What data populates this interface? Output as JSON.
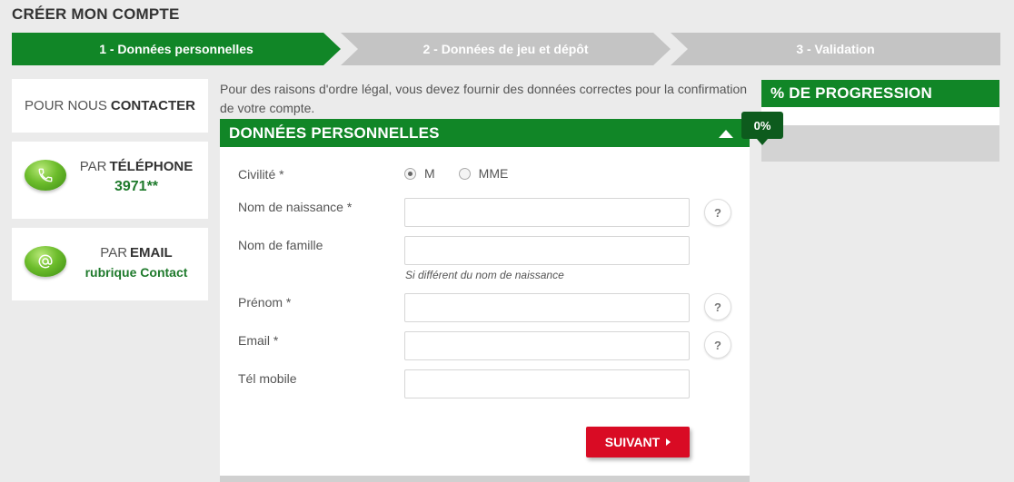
{
  "page": {
    "title": "CRÉER MON COMPTE"
  },
  "steps": [
    {
      "label": "1 - Données personnelles",
      "active": true
    },
    {
      "label": "2 - Données de jeu et dépôt",
      "active": false
    },
    {
      "label": "3 - Validation",
      "active": false
    }
  ],
  "contact": {
    "title_prefix": "POUR NOUS",
    "title_strong": "CONTACTER",
    "phone": {
      "prefix": "PAR",
      "label": "TÉLÉPHONE",
      "value": "3971**",
      "icon": "phone-icon"
    },
    "email": {
      "prefix": "PAR",
      "label": "EMAIL",
      "value": "rubrique Contact",
      "icon": "at-sign-icon"
    }
  },
  "intro": "Pour des raisons d'ordre légal, vous devez fournir des données correctes pour la confirmation de votre compte.",
  "form": {
    "section_title": "DONNÉES PERSONNELLES",
    "civility": {
      "label": "Civilité *",
      "options": [
        "M",
        "MME"
      ],
      "selected": "M"
    },
    "birth_name": {
      "label": "Nom de naissance *",
      "value": ""
    },
    "family_name": {
      "label": "Nom de famille",
      "value": "",
      "hint": "Si différent du nom de naissance"
    },
    "first_name": {
      "label": "Prénom *",
      "value": ""
    },
    "email": {
      "label": "Email *",
      "value": ""
    },
    "mobile": {
      "label": "Tél mobile",
      "value": ""
    },
    "help_symbol": "?",
    "submit_label": "SUIVANT"
  },
  "progress": {
    "title": "% DE PROGRESSION",
    "value_label": "0%",
    "value": 0
  },
  "colors": {
    "brand_green": "#118627",
    "dark_green": "#0d5b1d",
    "cta_red": "#d90b24",
    "inactive_step": "#c4c4c4"
  }
}
